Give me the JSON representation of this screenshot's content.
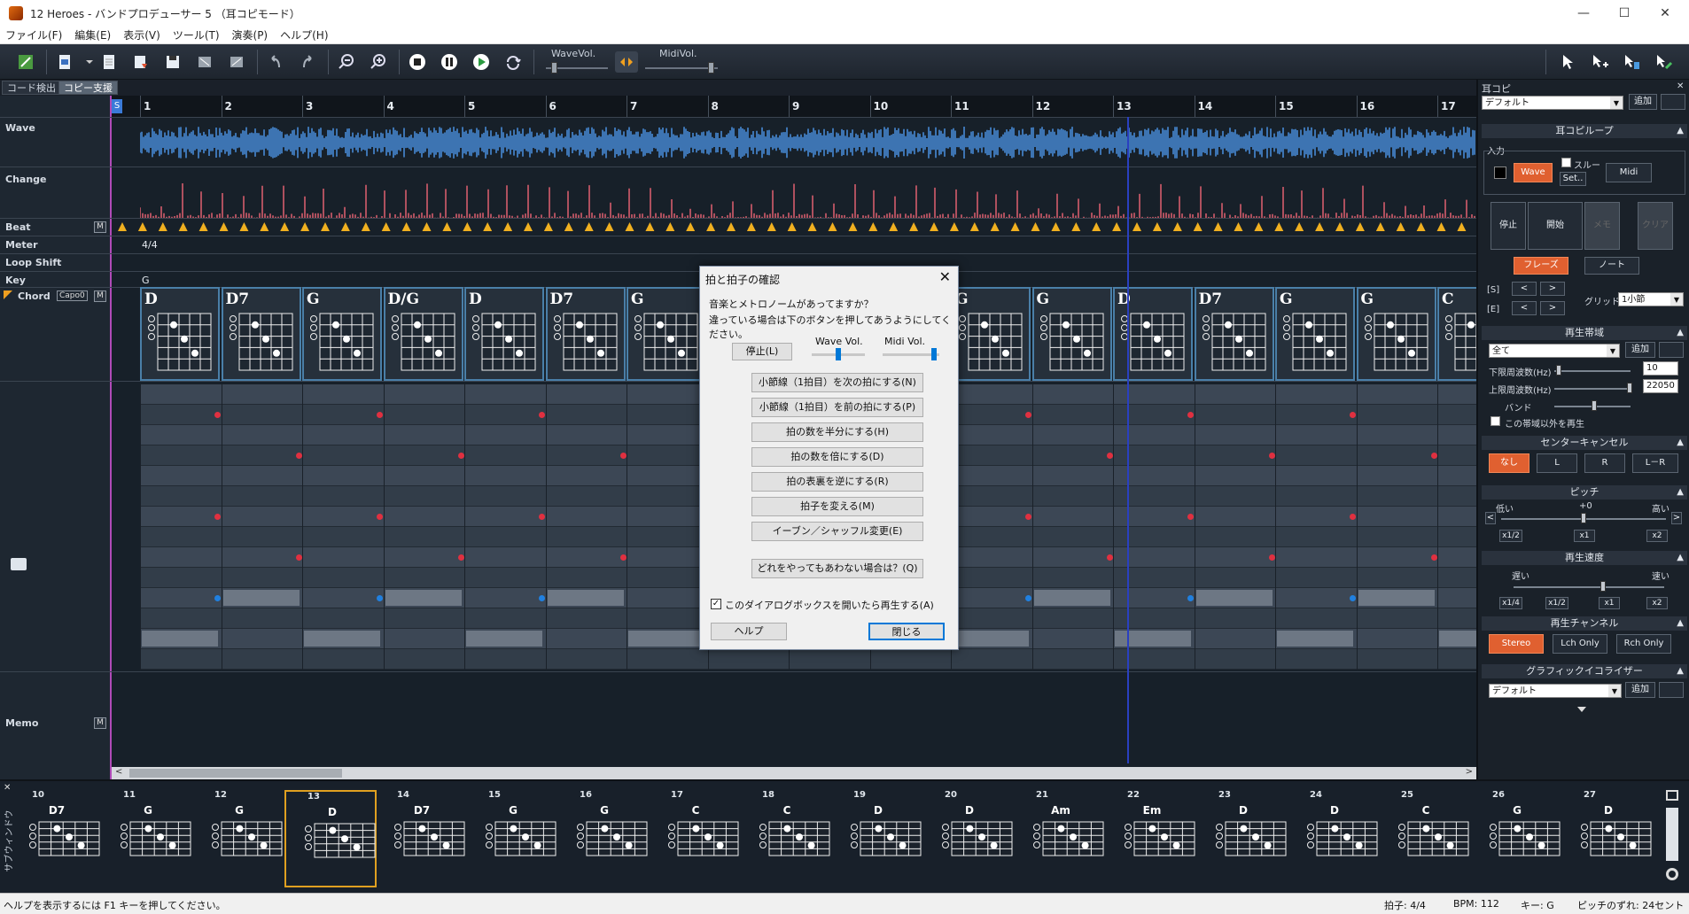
{
  "window": {
    "title": "12 Heroes - バンドプロデューサー 5 （耳コピモード）",
    "minimize": "—",
    "maximize": "☐",
    "close": "✕"
  },
  "menu": [
    "ファイル(F)",
    "編集(E)",
    "表示(V)",
    "ツール(T)",
    "演奏(P)",
    "ヘルプ(H)"
  ],
  "toolbar": {
    "wave_vol_label": "WaveVol.",
    "midi_vol_label": "MidiVol.",
    "wave_vol_level": 0.1,
    "midi_vol_level": 0.95
  },
  "tabs": [
    "コード検出",
    "コピー支援"
  ],
  "tracks": {
    "labels": [
      "Wave",
      "Change",
      "Beat",
      "Meter",
      "Loop Shift",
      "Key",
      "Chord",
      "Memo"
    ],
    "capo": "Capo0",
    "m_button": "M",
    "meter_value": "4/4",
    "key_value": "G",
    "start_marker": "S"
  },
  "bars": [
    "1",
    "2",
    "3",
    "4",
    "5",
    "6",
    "7",
    "8",
    "9",
    "10",
    "11",
    "12",
    "13",
    "14",
    "15",
    "16",
    "17"
  ],
  "chords_top": [
    "D",
    "D7",
    "G",
    "D/G",
    "D",
    "D7",
    "G",
    "",
    "",
    "",
    "G",
    "G",
    "D",
    "D7",
    "G",
    "G",
    "C"
  ],
  "dialog": {
    "title": "拍と拍子の確認",
    "close": "✕",
    "line1": "音楽とメトロノームがあってますか？",
    "line2": "違っている場合は下のボタンを押してあうようにしてください。",
    "stop_button": "停止(L)",
    "wave_vol_label": "Wave Vol.",
    "midi_vol_label": "Midi Vol.",
    "wave_vol_level": 0.5,
    "midi_vol_level": 0.95,
    "buttons": [
      "小節線（1拍目）を次の拍にする(N)",
      "小節線（1拍目）を前の拍にする(P)",
      "拍の数を半分にする(H)",
      "拍の数を倍にする(D)",
      "拍の表裏を逆にする(R)",
      "拍子を変える(M)",
      "イーブン／シャッフル変更(E)"
    ],
    "none_button": "どれをやってもあわない場合は？(Q)",
    "checkbox_label": "このダイアログボックスを開いたら再生する(A)",
    "checkbox_checked": true,
    "help_button": "ヘルプ",
    "close_button": "閉じる"
  },
  "right_panel": {
    "header": "耳コピ",
    "preset_value": "デフォルト",
    "add": "追加",
    "loop_section": "耳コピループ",
    "input_label": "入力",
    "wave_btn": "Wave",
    "through_label": "スルー",
    "midi_btn": "Midi",
    "set_btn": "Set..",
    "stop_btn": "停止",
    "start_btn": "開始",
    "memo_btn": "メモ",
    "clear_btn": "クリア",
    "phrase_btn": "フレーズ",
    "note_btn": "ノート",
    "s_label": "[S]",
    "e_label": "[E]",
    "prev": "<",
    "next": ">",
    "grid_label": "グリッド",
    "grid_value": "1小節",
    "band_section": "再生帯域",
    "band_value": "全て",
    "low_freq_label": "下限周波数(Hz)",
    "low_freq_value": "10",
    "high_freq_label": "上限周波数(Hz)",
    "high_freq_value": "22050",
    "band_label": "バンド",
    "outside_band_label": "この帯域以外を再生",
    "center_section": "センターキャンセル",
    "center_none": "なし",
    "center_l": "L",
    "center_r": "R",
    "center_lr": "L－R",
    "pitch_section": "ピッチ",
    "pitch_low": "低い",
    "pitch_zero": "+0",
    "pitch_high": "高い",
    "pitch_half": "x1/2",
    "pitch_one": "x1",
    "pitch_two": "x2",
    "speed_section": "再生速度",
    "speed_slow": "遅い",
    "speed_fast": "速い",
    "speed_quarter": "x1/4",
    "speed_half": "x1/2",
    "speed_one": "x1",
    "speed_two": "x2",
    "channel_section": "再生チャンネル",
    "stereo_btn": "Stereo",
    "lch_btn": "Lch Only",
    "rch_btn": "Rch Only",
    "eq_section": "グラフィックイコライザー",
    "eq_value": "デフォルト"
  },
  "bottom_strip": {
    "side_label": "サブウィンドウ",
    "bars": [
      "10",
      "11",
      "12",
      "13",
      "14",
      "15",
      "16",
      "17",
      "18",
      "19",
      "20",
      "21",
      "22",
      "23",
      "24",
      "25",
      "26",
      "27"
    ],
    "chords": [
      "D7",
      "G",
      "G",
      "D",
      "D7",
      "G",
      "G",
      "C",
      "C",
      "D",
      "D",
      "Am",
      "Em",
      "D",
      "D",
      "C",
      "G",
      "D"
    ],
    "selected_index": 3
  },
  "status": {
    "help": "ヘルプを表示するには F1 キーを押してください。",
    "beat": "拍子: 4/4",
    "bpm": "BPM: 112",
    "key": "キー: G",
    "pitch_offset": "ピッチのずれ: 24セント"
  },
  "colors": {
    "wave": "#4a90e0",
    "change": "#e06070",
    "beat_marker": "#f0b020",
    "accent_orange": "#e06030",
    "playhead": "#2a40c0",
    "note_red": "#e03040",
    "note_blue": "#2080e0"
  }
}
